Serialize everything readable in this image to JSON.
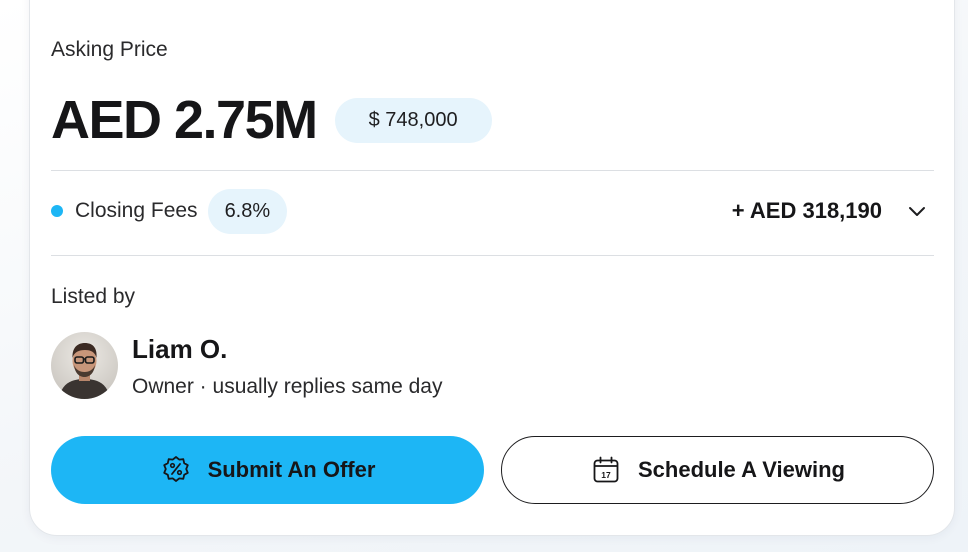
{
  "pricing": {
    "asking_label": "Asking Price",
    "price": "AED 2.75M",
    "usd_equivalent": "$ 748,000"
  },
  "closing_fees": {
    "label": "Closing Fees",
    "percentage": "6.8%",
    "amount": "+ AED 318,190",
    "expand_icon": "chevron-down-icon"
  },
  "listing": {
    "listed_by_label": "Listed by",
    "owner_name": "Liam O.",
    "owner_subtitle": "Owner · usually replies same day"
  },
  "actions": {
    "submit_offer_label": "Submit An Offer",
    "submit_offer_icon": "discount-badge-icon",
    "schedule_viewing_label": "Schedule A Viewing",
    "schedule_viewing_icon": "calendar-icon",
    "calendar_day": "17"
  },
  "colors": {
    "accent": "#1db6f5",
    "pill_background": "#e6f4fc",
    "text_primary": "#161618"
  }
}
